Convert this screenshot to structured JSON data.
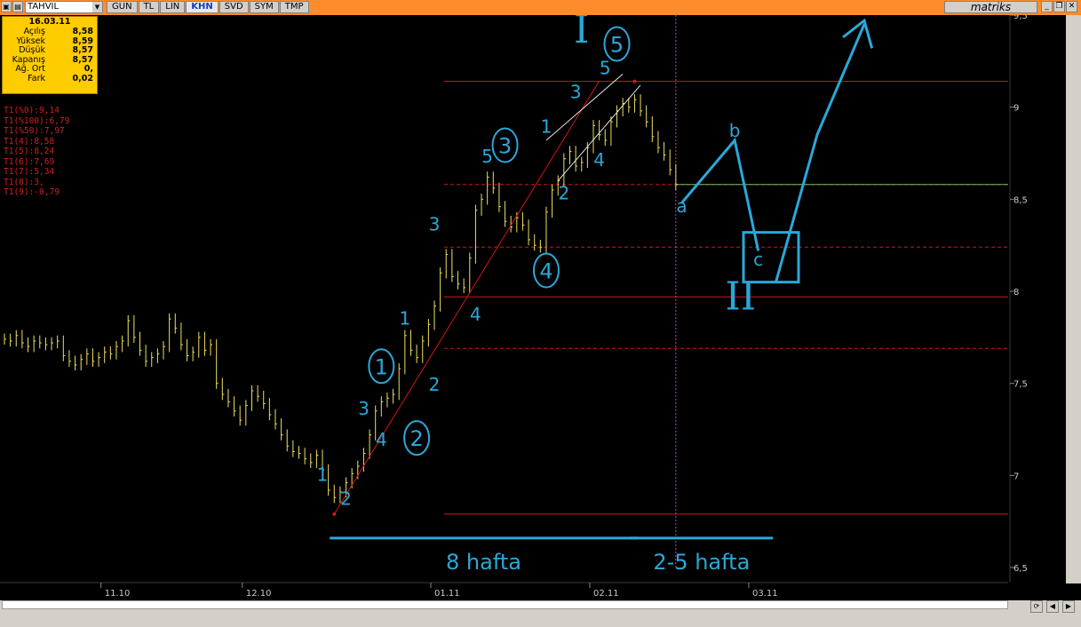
{
  "toolbar": {
    "symbol": "TAHVIL",
    "tabs": [
      "GUN",
      "TL",
      "LIN",
      "KHN",
      "SVD",
      "SYM",
      "TMP"
    ],
    "active_tab": "KHN",
    "brand": "matriks"
  },
  "info_box": {
    "date": "16.03.11",
    "rows": [
      {
        "label": "Açılış",
        "value": "8,58"
      },
      {
        "label": "Yüksek",
        "value": "8,59"
      },
      {
        "label": "Düşük",
        "value": "8,57"
      },
      {
        "label": "Kapanış",
        "value": "8,57"
      },
      {
        "label": "Ağ. Ort",
        "value": "0,"
      },
      {
        "label": "Fark",
        "value": "0,02"
      }
    ]
  },
  "levels": [
    "T1(%0):9,14",
    "T1(%100):6,79",
    "T1(%50):7,97",
    "T1(4):8,58",
    "T1(5):8,24",
    "T1(6):7,69",
    "T1(7):5,34",
    "T1(8):3,",
    "T1(9):-0,79"
  ],
  "colors": {
    "background": "#000000",
    "bars": "#f0e060",
    "level_lines": "#d01818",
    "annotations": "#2aa8d8",
    "toolbar": "#ff8c2a"
  },
  "chart_data": {
    "type": "bar",
    "title": "",
    "xlabel": "",
    "ylabel": "",
    "ylim": [
      6.5,
      9.5
    ],
    "y_ticks": [
      "9,5",
      "9",
      "8,5",
      "8",
      "7,5",
      "7",
      "6,5"
    ],
    "x_ticks": [
      "11.10",
      "12.10",
      "01.11",
      "02.11",
      "03.11"
    ],
    "level_lines": [
      {
        "value": 9.14,
        "style": "solid"
      },
      {
        "value": 8.58,
        "style": "dashed"
      },
      {
        "value": 8.24,
        "style": "dashed"
      },
      {
        "value": 7.97,
        "style": "solid"
      },
      {
        "value": 7.69,
        "style": "dashed"
      },
      {
        "value": 6.79,
        "style": "solid"
      }
    ],
    "prices": [
      7.74,
      7.73,
      7.76,
      7.72,
      7.7,
      7.73,
      7.72,
      7.71,
      7.72,
      7.73,
      7.65,
      7.62,
      7.6,
      7.63,
      7.66,
      7.62,
      7.64,
      7.67,
      7.66,
      7.7,
      7.73,
      7.84,
      7.75,
      7.68,
      7.62,
      7.64,
      7.66,
      7.7,
      7.85,
      7.8,
      7.71,
      7.65,
      7.67,
      7.75,
      7.68,
      7.71,
      7.5,
      7.44,
      7.4,
      7.35,
      7.3,
      7.38,
      7.46,
      7.43,
      7.39,
      7.33,
      7.28,
      7.22,
      7.16,
      7.13,
      7.12,
      7.09,
      7.07,
      7.11,
      7.03,
      6.92,
      6.88,
      6.91,
      6.96,
      7.01,
      7.05,
      7.12,
      7.22,
      7.35,
      7.4,
      7.42,
      7.44,
      7.58,
      7.76,
      7.68,
      7.64,
      7.73,
      7.82,
      7.92,
      8.1,
      8.2,
      8.08,
      8.04,
      8.02,
      8.18,
      8.44,
      8.5,
      8.62,
      8.56,
      8.46,
      8.38,
      8.35,
      8.4,
      8.36,
      8.28,
      8.25,
      8.24,
      8.43,
      8.55,
      8.6,
      8.72,
      8.76,
      8.68,
      8.7,
      8.78,
      8.9,
      8.85,
      8.82,
      8.92,
      8.98,
      9.02,
      9.0,
      9.04,
      8.98,
      8.92,
      8.84,
      8.78,
      8.74,
      8.66,
      8.58
    ],
    "marker_prices": [
      {
        "bar": 56,
        "label": "6,79"
      },
      {
        "bar": 107,
        "label": "9,14"
      }
    ],
    "cursor_bar": 114,
    "annotations": {
      "wave_labels_small": [
        {
          "text": "1",
          "bar": 54,
          "price": 6.97
        },
        {
          "text": "2",
          "bar": 58,
          "price": 6.84
        },
        {
          "text": "3",
          "bar": 61,
          "price": 7.33
        },
        {
          "text": "4",
          "bar": 64,
          "price": 7.16
        },
        {
          "text": "1",
          "bar": 68,
          "price": 7.82
        },
        {
          "text": "2",
          "bar": 73,
          "price": 7.46
        },
        {
          "text": "3",
          "bar": 73,
          "price": 8.33
        },
        {
          "text": "4",
          "bar": 80,
          "price": 7.84
        },
        {
          "text": "5",
          "bar": 82,
          "price": 8.7
        },
        {
          "text": "1",
          "bar": 92,
          "price": 8.86
        },
        {
          "text": "2",
          "bar": 95,
          "price": 8.5
        },
        {
          "text": "3",
          "bar": 97,
          "price": 9.05
        },
        {
          "text": "4",
          "bar": 101,
          "price": 8.68
        },
        {
          "text": "5",
          "bar": 102,
          "price": 9.18
        },
        {
          "text": "a",
          "bar": 115,
          "price": 8.43
        },
        {
          "text": "b",
          "bar": 124,
          "price": 8.84
        },
        {
          "text": "c",
          "bar": 128,
          "price": 8.14
        }
      ],
      "wave_labels_circled": [
        {
          "text": "1",
          "bar": 64,
          "price": 7.55
        },
        {
          "text": "2",
          "bar": 70,
          "price": 7.16
        },
        {
          "text": "3",
          "bar": 85,
          "price": 8.75
        },
        {
          "text": "4",
          "bar": 92,
          "price": 8.07
        },
        {
          "text": "5",
          "bar": 104,
          "price": 9.3
        }
      ],
      "roman_labels": [
        {
          "text": "I",
          "bar": 98,
          "price": 9.35
        },
        {
          "text": "II",
          "bar": 125,
          "price": 7.9
        }
      ],
      "periods": [
        {
          "text": "8 hafta",
          "from_bar": 56,
          "to_bar": 106
        },
        {
          "text": "2-5 hafta",
          "from_bar": 107,
          "to_bar": 129
        }
      ]
    }
  }
}
